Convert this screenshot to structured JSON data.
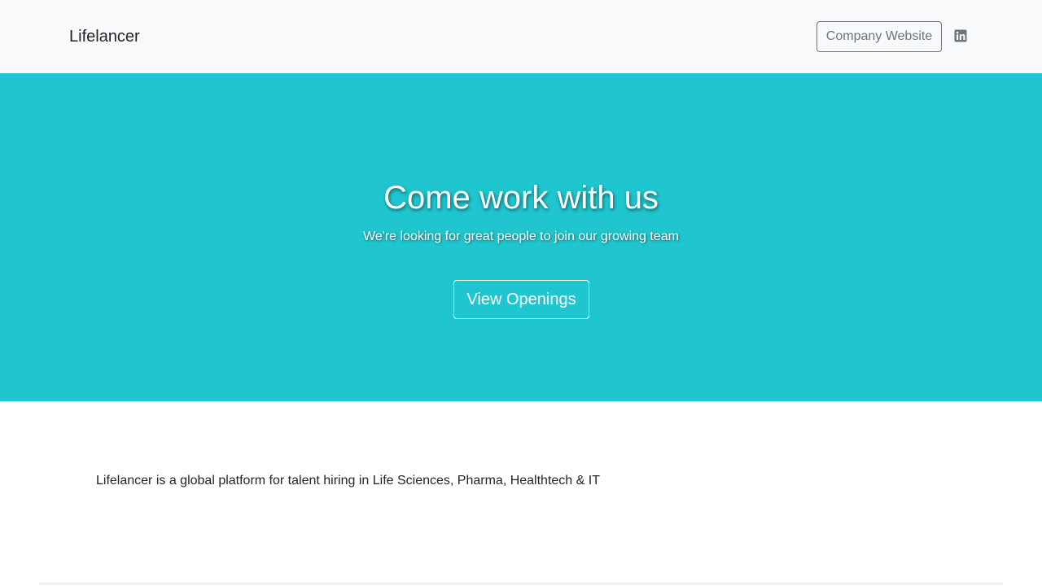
{
  "header": {
    "brand": "Lifelancer",
    "company_website_label": "Company Website",
    "social_icon": "linkedin-icon"
  },
  "hero": {
    "title": "Come work with us",
    "subtitle": "We're looking for great people to join our growing team",
    "cta_label": "View Openings",
    "background_color": "#1fc6cf"
  },
  "about": {
    "text": "Lifelancer is a global platform for talent hiring in Life Sciences, Pharma, Healthtech & IT"
  },
  "colors": {
    "navbar_bg": "#f8f9fa",
    "hero_bg": "#1fc6cf",
    "muted": "#6c757d"
  }
}
